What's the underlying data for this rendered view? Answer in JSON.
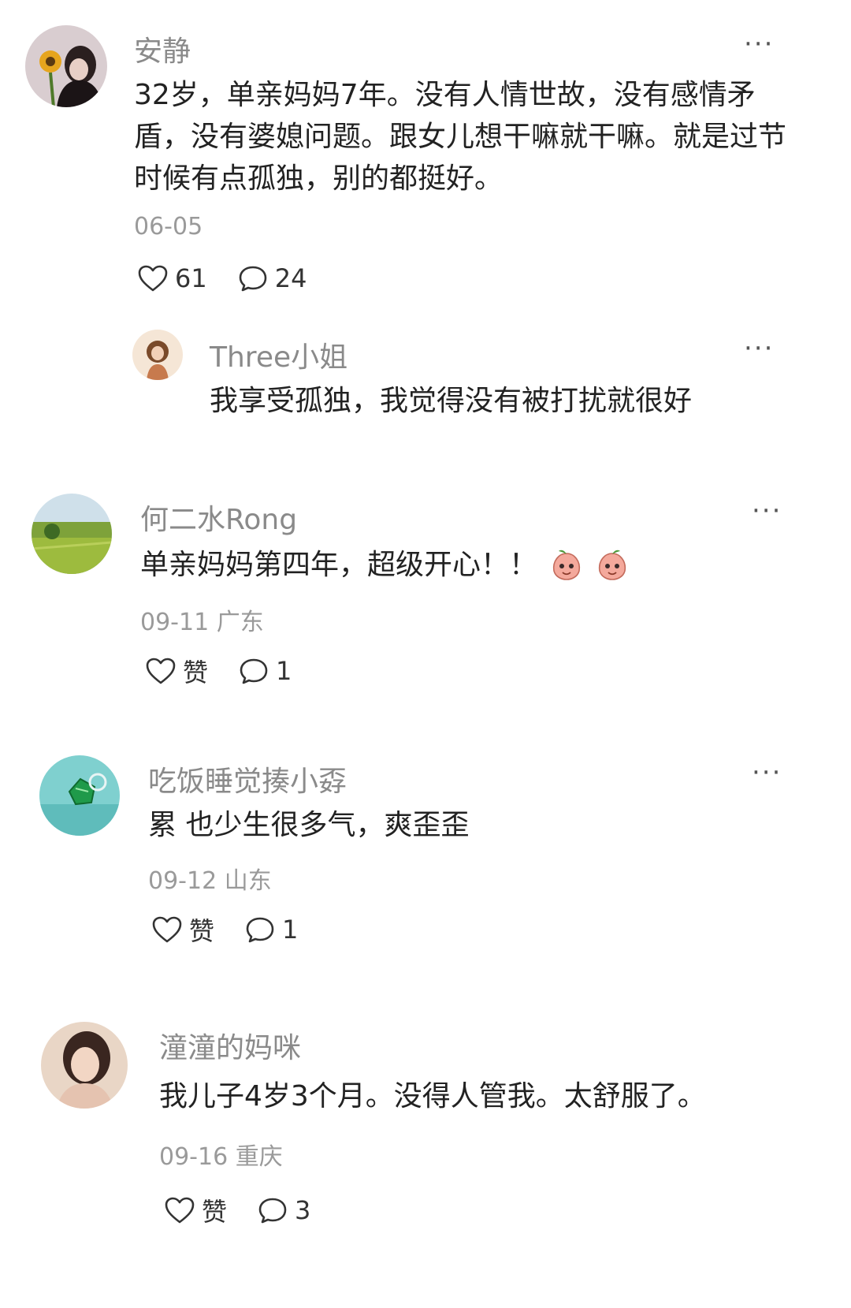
{
  "comments": [
    {
      "username": "安静",
      "text": "32岁，单亲妈妈7年。没有人情世故，没有感情矛盾，没有婆媳问题。跟女儿想干嘛就干嘛。就是过节时候有点孤独，别的都挺好。",
      "meta": "06-05",
      "likes": "61",
      "replies_count": "24",
      "reply": {
        "username": "Three小姐",
        "text": "我享受孤独，我觉得没有被打扰就很好"
      }
    },
    {
      "username": "何二水Rong",
      "text": "单亲妈妈第四年，超级开心！！",
      "meta": "09-11 广东",
      "likes": "赞",
      "replies_count": "1"
    },
    {
      "username": "吃饭睡觉揍小孬",
      "text": "累 也少生很多气，爽歪歪",
      "meta": "09-12 山东",
      "likes": "赞",
      "replies_count": "1"
    },
    {
      "username": "潼潼的妈咪",
      "text": "我儿子4岁3个月。没得人管我。太舒服了。",
      "meta": "09-16 重庆",
      "likes": "赞",
      "replies_count": "3"
    }
  ],
  "icons": {
    "like": "heart-outline-icon",
    "reply": "speech-bubble-icon",
    "more": "more-dots-icon"
  },
  "more_label": "···"
}
